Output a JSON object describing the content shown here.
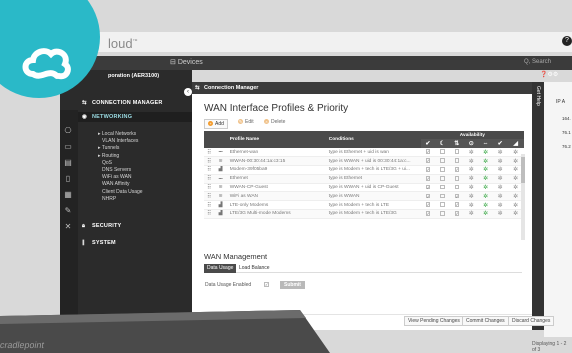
{
  "app": {
    "brand": "loud",
    "brand_tm": "™",
    "tabs": {
      "devices": "Devices"
    },
    "search": "Q, Search",
    "help": "?"
  },
  "sidebar": {
    "title": "poration (AER3100)",
    "sections": {
      "connection_manager": "CONNECTION MANAGER",
      "networking": "NETWORKING",
      "security": "SECURITY",
      "system": "SYSTEM"
    },
    "items": [
      {
        "label": "Local Networks",
        "kind": "top"
      },
      {
        "label": "VLAN Interfaces",
        "kind": "child"
      },
      {
        "label": "Tunnels",
        "kind": "top"
      },
      {
        "label": "Routing",
        "kind": "top"
      },
      {
        "label": "QoS",
        "kind": "child"
      },
      {
        "label": "DNS Servers",
        "kind": "child"
      },
      {
        "label": "WiFi as WAN",
        "kind": "child"
      },
      {
        "label": "WAN Affinity",
        "kind": "child"
      },
      {
        "label": "Client Data Usage",
        "kind": "child"
      },
      {
        "label": "NHRP",
        "kind": "child"
      }
    ]
  },
  "modal": {
    "header": "Connection Manager",
    "section_title": "WAN Interface Profiles & Priority",
    "toolbar": {
      "add": "Add",
      "edit": "Edit",
      "delete": "Delete"
    },
    "columns": {
      "profile_name": "Profile Name",
      "conditions": "Conditions",
      "availability": "Availability"
    },
    "availability_icons": [
      "check-icon",
      "moon-icon",
      "signal-bars-icon",
      "target-icon",
      "double-arrow-icon",
      "check-icon",
      "signal-icon"
    ],
    "rows": [
      {
        "name": "Ethernet-wan",
        "icon": "ethernet-icon",
        "conditions": "type is Ethernet + uid is wan",
        "checks": [
          true,
          false,
          false
        ],
        "green": true
      },
      {
        "name": "WWAN-00:30:44:1a:c3:15",
        "icon": "wifi-icon",
        "conditions": "type is WWAN + uid is 00:30:44:1a:c...",
        "checks": [
          true,
          false,
          false
        ],
        "green": true
      },
      {
        "name": "Modem-39f05ba9",
        "icon": "signal-bars-icon",
        "conditions": "type is Modem + tech is LTE/3G + ui...",
        "checks": [
          true,
          false,
          true
        ],
        "green": true
      },
      {
        "name": "Ethernet",
        "icon": "ethernet-icon",
        "conditions": "type is Ethernet",
        "checks": [
          true,
          false,
          false
        ],
        "green": true
      },
      {
        "name": "WWAN-CP-Guest",
        "icon": "wifi-icon",
        "conditions": "type is WWAN + uid is CP-Guest",
        "checks": [
          true,
          false,
          false
        ],
        "green": true
      },
      {
        "name": "WiFi as WAN",
        "icon": "wifi-icon",
        "conditions": "type is WWAN",
        "checks": [
          true,
          false,
          true
        ],
        "green": true
      },
      {
        "name": "LTE-only Modems",
        "icon": "signal-bars-icon",
        "conditions": "type is Modem + tech is LTE",
        "checks": [
          true,
          false,
          true
        ],
        "green": true
      },
      {
        "name": "LTE/3G Multi-mode Modems",
        "icon": "signal-bars-icon",
        "conditions": "type is Modem + tech is LTE/3G",
        "checks": [
          true,
          false,
          true
        ],
        "green": true
      }
    ],
    "wan_management": {
      "title": "WAN Management",
      "tabs": [
        "Data Usage",
        "Load Balance"
      ],
      "data_usage_label": "Data Usage Enabled",
      "submit": "Submit"
    },
    "footer": {
      "view_pending": "View Pending Changes",
      "commit": "Commit Changes",
      "discard": "Discard Changes"
    }
  },
  "right_panel": {
    "rail_label": "Get Help",
    "header": "IP A",
    "cells": [
      "164.",
      "76.1",
      "76.2"
    ]
  },
  "status": {
    "displaying": "Displaying 1 - 2 of 3"
  },
  "colors": {
    "accent_teal": "#2ab9c8",
    "dark": "#2b2b2b",
    "green": "#39a845",
    "orange": "#f39b2b"
  }
}
